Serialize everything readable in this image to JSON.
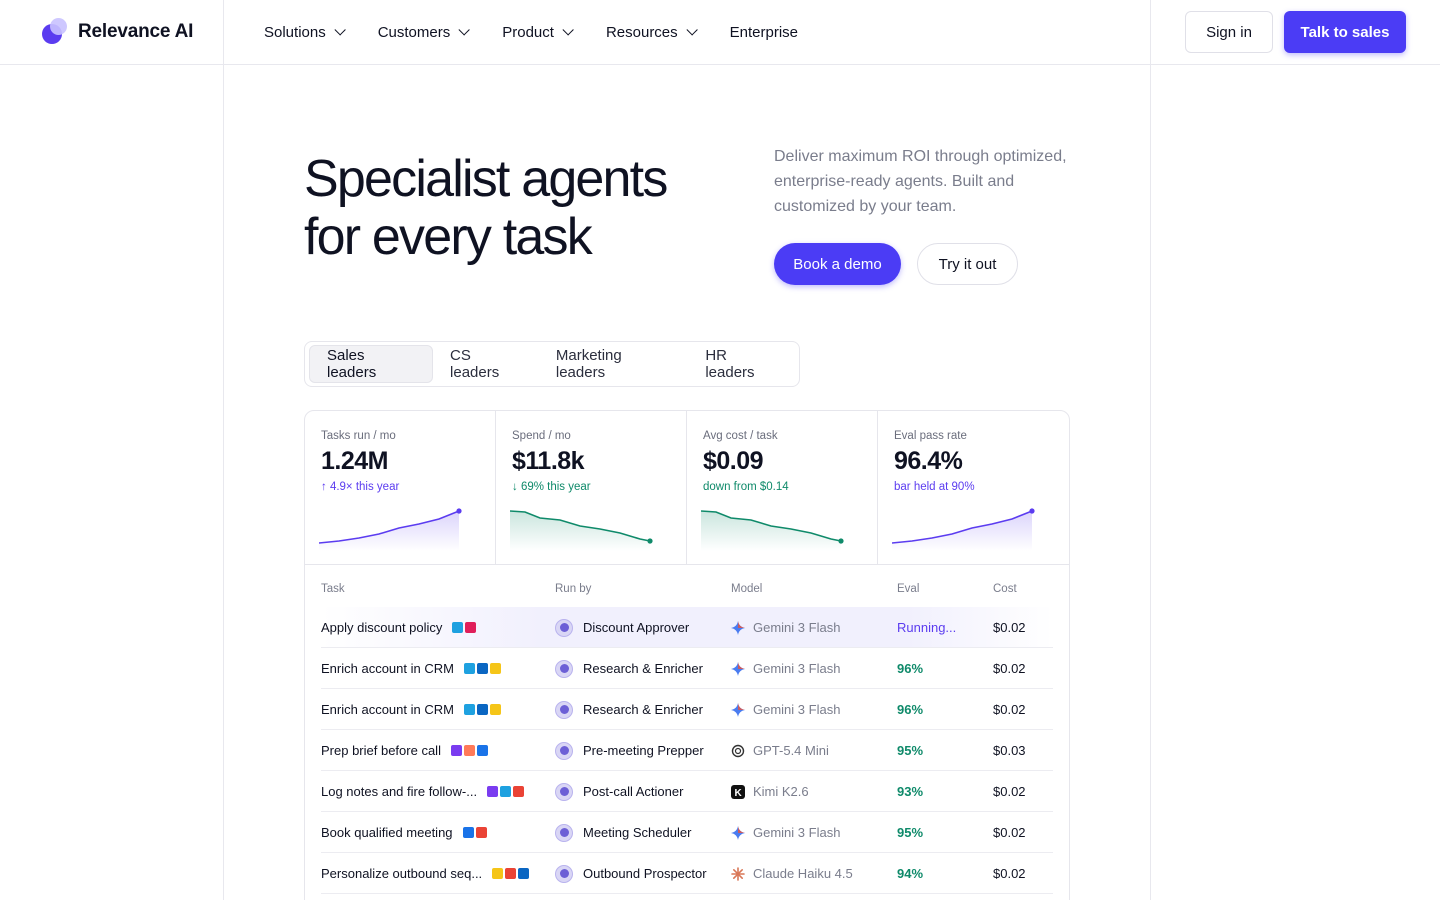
{
  "brand": {
    "name": "Relevance AI"
  },
  "nav": {
    "items": [
      {
        "label": "Solutions",
        "dropdown": true
      },
      {
        "label": "Customers",
        "dropdown": true
      },
      {
        "label": "Product",
        "dropdown": true
      },
      {
        "label": "Resources",
        "dropdown": true
      },
      {
        "label": "Enterprise",
        "dropdown": false
      }
    ],
    "signin": "Sign in",
    "talk": "Talk to sales"
  },
  "hero": {
    "title_line1": "Specialist agents",
    "title_line2": "for every task",
    "subtitle": "Deliver maximum ROI through optimized, enterprise-ready agents. Built and customized by your team.",
    "demo": "Book a demo",
    "try": "Try it out"
  },
  "tabs": [
    "Sales leaders",
    "CS leaders",
    "Marketing leaders",
    "HR leaders"
  ],
  "metrics": [
    {
      "label": "Tasks run / mo",
      "value": "1.24M",
      "delta": "↑ 4.9× this year",
      "color": "#5b3cf0",
      "trend": "up"
    },
    {
      "label": "Spend / mo",
      "value": "$11.8k",
      "delta": "↓ 69% this year",
      "color": "#0f8a6a",
      "trend": "down"
    },
    {
      "label": "Avg cost / task",
      "value": "$0.09",
      "delta": "down from $0.14",
      "color": "#0f8a6a",
      "trend": "down"
    },
    {
      "label": "Eval pass rate",
      "value": "96.4%",
      "delta": "bar held at 90%",
      "color": "#5b3cf0",
      "trend": "up"
    }
  ],
  "table": {
    "headers": {
      "task": "Task",
      "runby": "Run by",
      "model": "Model",
      "eval": "Eval",
      "cost": "Cost"
    },
    "rows": [
      {
        "task": "Apply discount policy",
        "apps": [
          "salesforce",
          "slack"
        ],
        "runby": "Discount Approver",
        "model": "Gemini 3 Flash",
        "model_icon": "gemini",
        "eval": "Running...",
        "cost": "$0.02"
      },
      {
        "task": "Enrich account in CRM",
        "apps": [
          "salesforce",
          "linkedin",
          "apollo"
        ],
        "runby": "Research & Enricher",
        "model": "Gemini 3 Flash",
        "model_icon": "gemini",
        "eval": "96%",
        "cost": "$0.02"
      },
      {
        "task": "Enrich account in CRM",
        "apps": [
          "salesforce",
          "linkedin",
          "apollo"
        ],
        "runby": "Research & Enricher",
        "model": "Gemini 3 Flash",
        "model_icon": "gemini",
        "eval": "96%",
        "cost": "$0.02"
      },
      {
        "task": "Prep brief before call",
        "apps": [
          "gong",
          "hubspot",
          "calendar"
        ],
        "runby": "Pre-meeting Prepper",
        "model": "GPT-5.4 Mini",
        "model_icon": "openai",
        "eval": "95%",
        "cost": "$0.03"
      },
      {
        "task": "Log notes and fire follow-...",
        "apps": [
          "gong",
          "salesforce",
          "gmail"
        ],
        "runby": "Post-call Actioner",
        "model": "Kimi K2.6",
        "model_icon": "kimi",
        "eval": "93%",
        "cost": "$0.02"
      },
      {
        "task": "Book qualified meeting",
        "apps": [
          "calendar",
          "gmail"
        ],
        "runby": "Meeting Scheduler",
        "model": "Gemini 3 Flash",
        "model_icon": "gemini",
        "eval": "95%",
        "cost": "$0.02"
      },
      {
        "task": "Personalize outbound seq...",
        "apps": [
          "apollo",
          "gmail",
          "linkedin"
        ],
        "runby": "Outbound Prospector",
        "model": "Claude Haiku 4.5",
        "model_icon": "claude",
        "eval": "94%",
        "cost": "$0.02"
      }
    ]
  }
}
